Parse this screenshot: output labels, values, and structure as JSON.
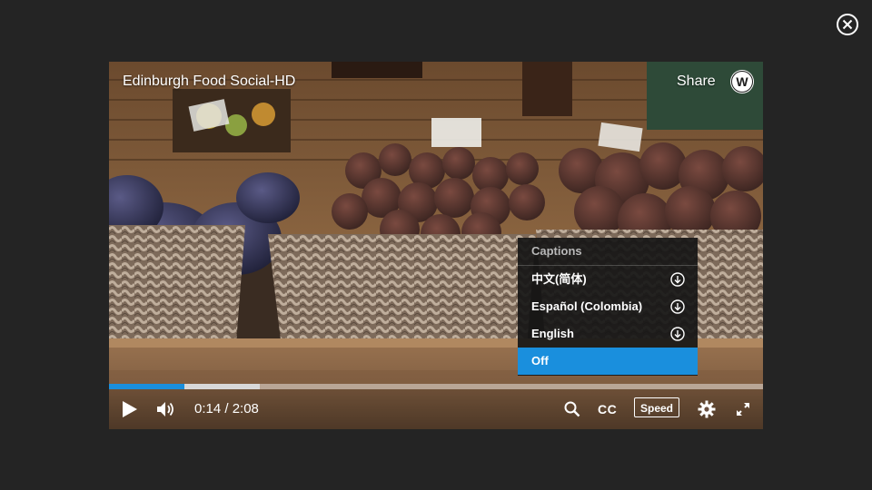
{
  "video": {
    "title": "Edinburgh Food Social-HD",
    "share_label": "Share",
    "logo_letter": "W"
  },
  "captions": {
    "header": "Captions",
    "items": [
      {
        "label": "中文(简体)",
        "downloadable": true,
        "selected": false
      },
      {
        "label": "Español (Colombia)",
        "downloadable": true,
        "selected": false
      },
      {
        "label": "English",
        "downloadable": true,
        "selected": false
      },
      {
        "label": "Off",
        "downloadable": false,
        "selected": true
      }
    ]
  },
  "playback": {
    "current_time": "0:14",
    "duration": "2:08",
    "time_display": "0:14 / 2:08",
    "played_fraction": 0.115,
    "buffered_fraction": 0.23
  },
  "controls": {
    "cc_label": "CC",
    "speed_label": "Speed",
    "icons": [
      "play-icon",
      "volume-icon",
      "search-icon",
      "settings-gear-icon",
      "fullscreen-icon",
      "close-icon",
      "download-icon"
    ]
  },
  "colors": {
    "accent": "#1a8fdd",
    "background": "#242424",
    "menu_bg": "#161616"
  }
}
